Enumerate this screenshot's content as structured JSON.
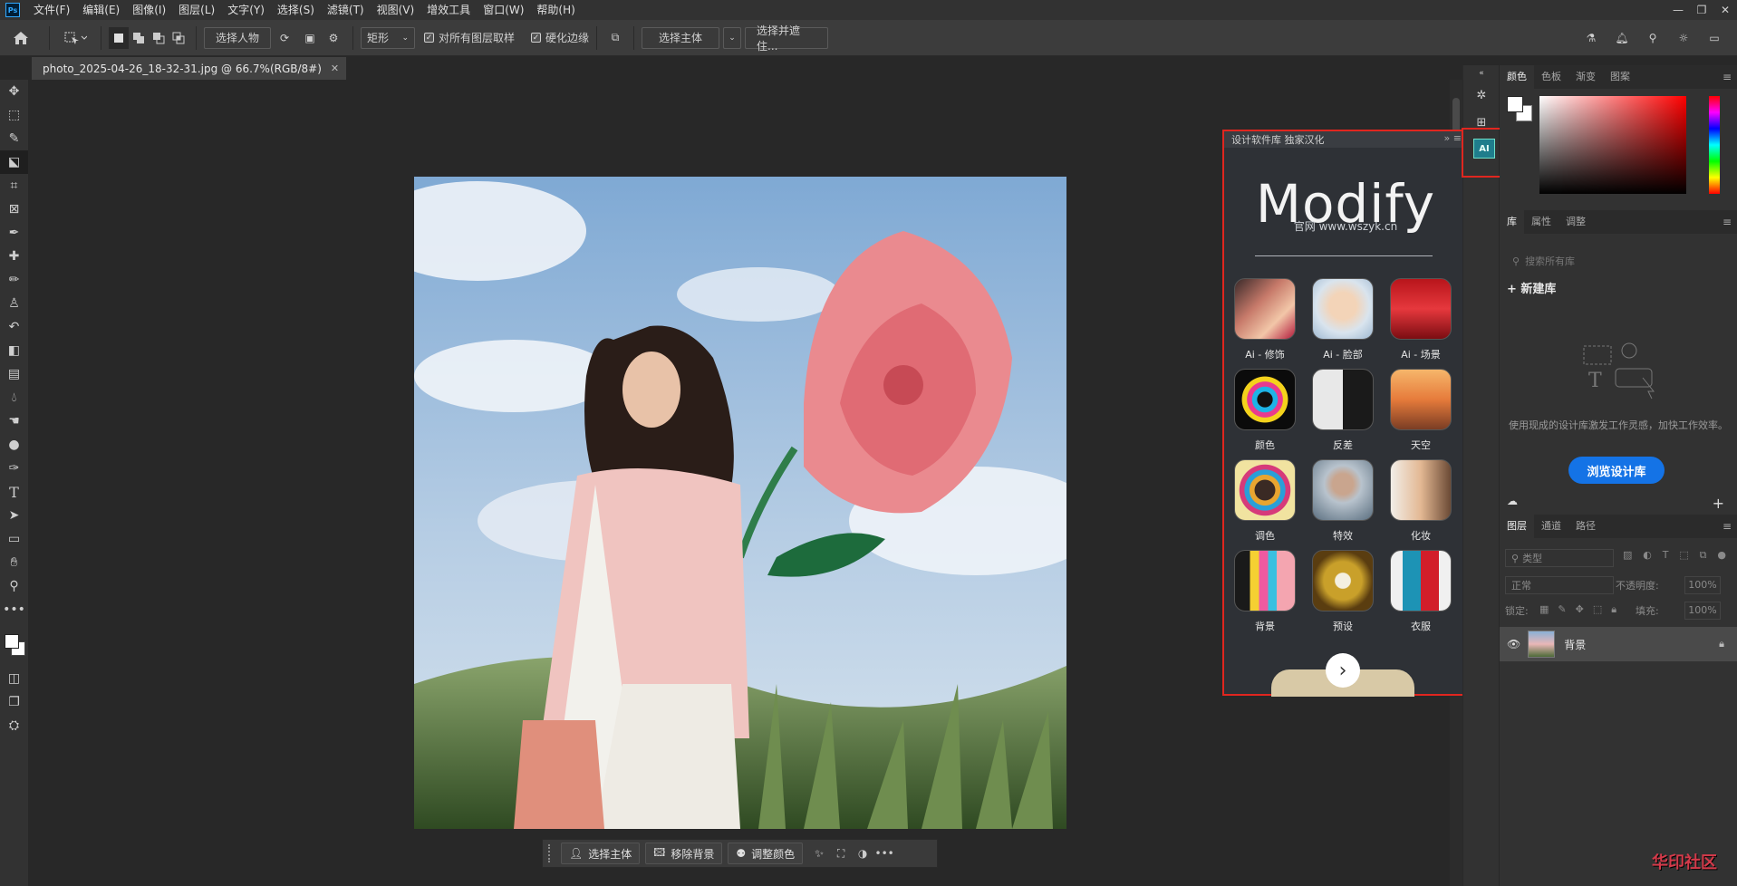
{
  "menubar": {
    "logo": "Ps",
    "items": [
      "文件(F)",
      "编辑(E)",
      "图像(I)",
      "图层(L)",
      "文字(Y)",
      "选择(S)",
      "滤镜(T)",
      "视图(V)",
      "增效工具",
      "窗口(W)",
      "帮助(H)"
    ]
  },
  "options": {
    "select_subject_person": "选择人物",
    "shape_mode": "矩形",
    "sample_all_layers": "对所有图层取样",
    "hard_edge": "硬化边缘",
    "select_subject": "选择主体",
    "select_and_mask": "选择并遮住..."
  },
  "document": {
    "tab_title": "photo_2025-04-26_18-32-31.jpg @ 66.7%(RGB/8#)"
  },
  "taskbar": {
    "select_subject": "选择主体",
    "remove_bg": "移除背景",
    "adjust_color": "调整颜色",
    "more": "•••"
  },
  "plugin": {
    "header": "设计软件库 独家汉化",
    "title": "Modify",
    "url": "官网 www.wszyk.cn",
    "items": [
      {
        "label": "Ai - 修饰"
      },
      {
        "label": "Ai - 脸部"
      },
      {
        "label": "Ai - 场景"
      },
      {
        "label": "颜色"
      },
      {
        "label": "反差"
      },
      {
        "label": "天空"
      },
      {
        "label": "调色"
      },
      {
        "label": "特效"
      },
      {
        "label": "化妆"
      },
      {
        "label": "背景"
      },
      {
        "label": "预设"
      },
      {
        "label": "衣服"
      }
    ],
    "next": "›"
  },
  "strip_badge": "AI",
  "panels": {
    "color_tabs": [
      "颜色",
      "色板",
      "渐变",
      "图案"
    ],
    "library_tabs": [
      "库",
      "属性",
      "调整"
    ],
    "library_search": "搜索所有库",
    "new_library": "+ 新建库",
    "library_desc": "使用现成的设计库激发工作灵感，加快工作效率。",
    "browse_library": "浏览设计库",
    "layer_tabs": [
      "图层",
      "通道",
      "路径"
    ],
    "layer_filter": "类型",
    "blend_mode": "正常",
    "opacity_label": "不透明度:",
    "opacity_value": "100%",
    "lock_label": "锁定:",
    "fill_label": "填充:",
    "fill_value": "100%",
    "layer_name": "背景"
  },
  "watermark": "华印社区"
}
